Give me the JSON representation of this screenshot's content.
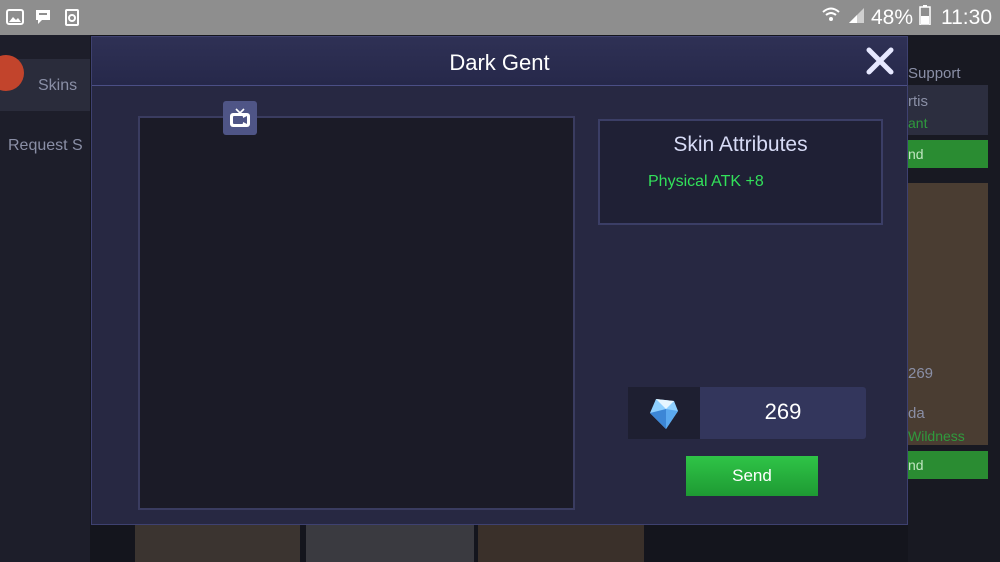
{
  "status_bar": {
    "battery_percent": "48%",
    "time": "11:30",
    "left_icons": [
      "gallery-icon",
      "chat-icon",
      "recycle-icon"
    ],
    "right_icons": [
      "wifi-icon",
      "signal-icon",
      "battery-icon"
    ]
  },
  "background": {
    "tab_skins": "Skins",
    "tab_request": "Request S",
    "right_header": "Support",
    "card_texts": [
      "rtis",
      "ant",
      "nd",
      "269",
      "da",
      "Wildness",
      "nd"
    ]
  },
  "dialog": {
    "title": "Dark Gent",
    "attributes": {
      "title": "Skin Attributes",
      "items": [
        "Physical ATK +8"
      ]
    },
    "price": {
      "value": "269",
      "currency_icon": "diamond-icon"
    },
    "send_label": "Send"
  },
  "colors": {
    "accent_green": "#2fc447",
    "attribute_green": "#32e05a",
    "dialog_bg": "#272842"
  }
}
